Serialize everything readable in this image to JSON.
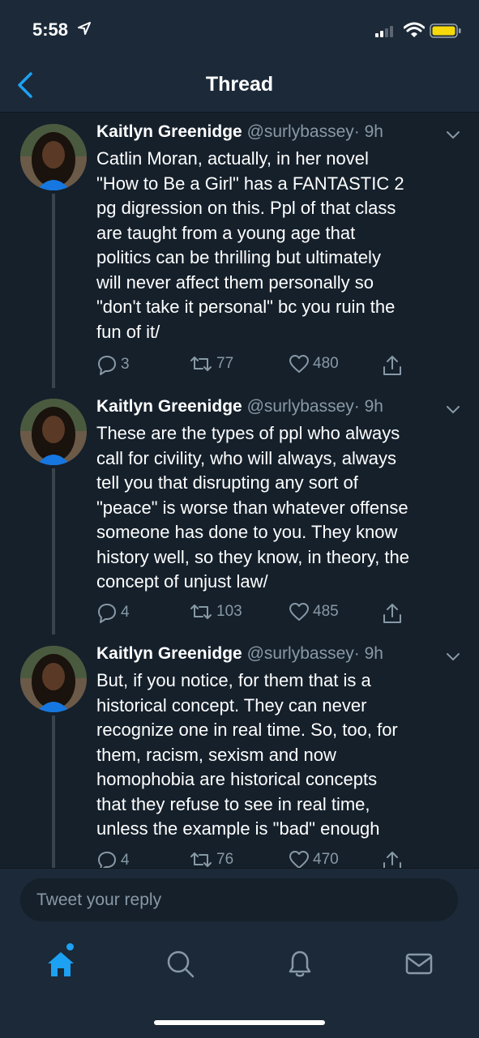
{
  "status": {
    "time": "5:58"
  },
  "nav": {
    "title": "Thread"
  },
  "tweets": [
    {
      "name": "Kaitlyn Greenidge",
      "handle": "@surlybassey",
      "age": "· 9h",
      "text": "Catlin Moran, actually, in her novel\n\"How to Be a Girl\" has a FANTASTIC 2\npg digression on this. Ppl of that class\nare taught from a young age that\npolitics can be thrilling but ultimately\nwill never affect them personally so\n\"don't take it personal\" bc you ruin the\nfun of it/",
      "replies": "3",
      "retweets": "77",
      "likes": "480"
    },
    {
      "name": "Kaitlyn Greenidge",
      "handle": "@surlybassey",
      "age": "· 9h",
      "text": "These are the types of ppl who always\ncall for civility, who will always, always\ntell you that disrupting any sort of\n\"peace\" is worse than whatever offense\nsomeone has done to you. They know\nhistory well, so they know, in theory, the\nconcept of unjust law/",
      "replies": "4",
      "retweets": "103",
      "likes": "485"
    },
    {
      "name": "Kaitlyn Greenidge",
      "handle": "@surlybassey",
      "age": "· 9h",
      "text": "But, if you notice, for them that is a\nhistorical concept. They can never\nrecognize one in real time. So, too, for\nthem, racism, sexism and now\nhomophobia are historical concepts\nthat they refuse to see in real time,\nunless the example is \"bad\" enough",
      "replies": "4",
      "retweets": "76",
      "likes": "470"
    }
  ],
  "reply": {
    "placeholder": "Tweet your reply"
  },
  "tabs": [
    "home-icon",
    "search-icon",
    "bell-icon",
    "mail-icon"
  ],
  "colors": {
    "background": "#15202b",
    "bars": "#1c2938",
    "accent": "#1da1f2",
    "muted": "#8899a6"
  }
}
